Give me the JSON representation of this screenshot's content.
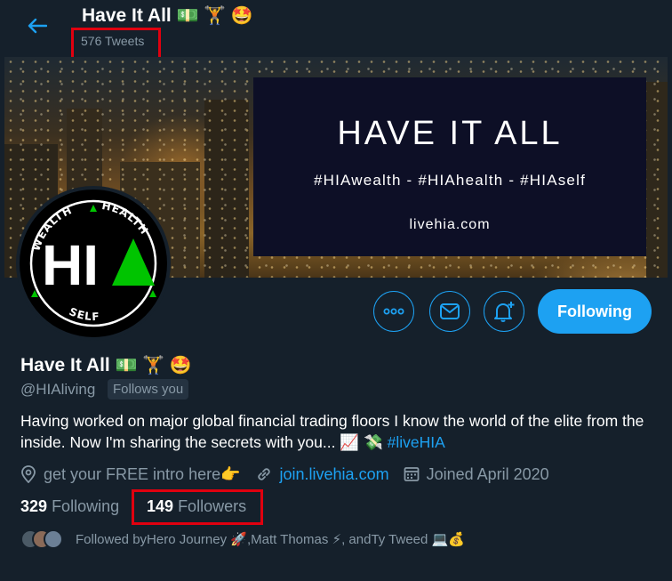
{
  "header": {
    "name": "Have It All",
    "emojis": "💵 🏋️ 🤩",
    "tweet_count": "576 Tweets"
  },
  "banner": {
    "title": "HAVE IT ALL",
    "hashtags": "#HIAwealth - #HIAhealth - #HIAself",
    "site": "livehia.com"
  },
  "avatar": {
    "top_text": "WEALTH",
    "right_text": "HEALTH",
    "bottom_text": "SELF",
    "center_text": "HI"
  },
  "actions": {
    "follow_label": "Following"
  },
  "profile": {
    "display_name": "Have It All",
    "emojis": "💵 🏋️ 🤩",
    "handle": "@HIAliving",
    "follows_you": "Follows you",
    "bio_text": "Having worked on major global financial trading floors I know the world of the elite from the inside. Now I'm sharing the secrets with you... ",
    "bio_emojis": "📈 💸",
    "bio_hashtag": "#liveHIA",
    "location": "get your FREE intro here👉",
    "url": "join.livehia.com",
    "joined": "Joined April 2020"
  },
  "stats": {
    "following_count": "329",
    "following_label": "Following",
    "followers_count": "149",
    "followers_label": "Followers"
  },
  "followed_by": {
    "prefix": "Followed by ",
    "user1": "Hero Journey 🚀",
    "sep1": ", ",
    "user2": "Matt Thomas ⚡",
    "sep2": ", and ",
    "user3": "Ty Tweed 💻💰"
  },
  "colors": {
    "background": "#15202b",
    "accent": "#1da1f2",
    "muted": "#8899a6",
    "highlight_box": "#e0000f",
    "logo_green": "#00c400"
  }
}
